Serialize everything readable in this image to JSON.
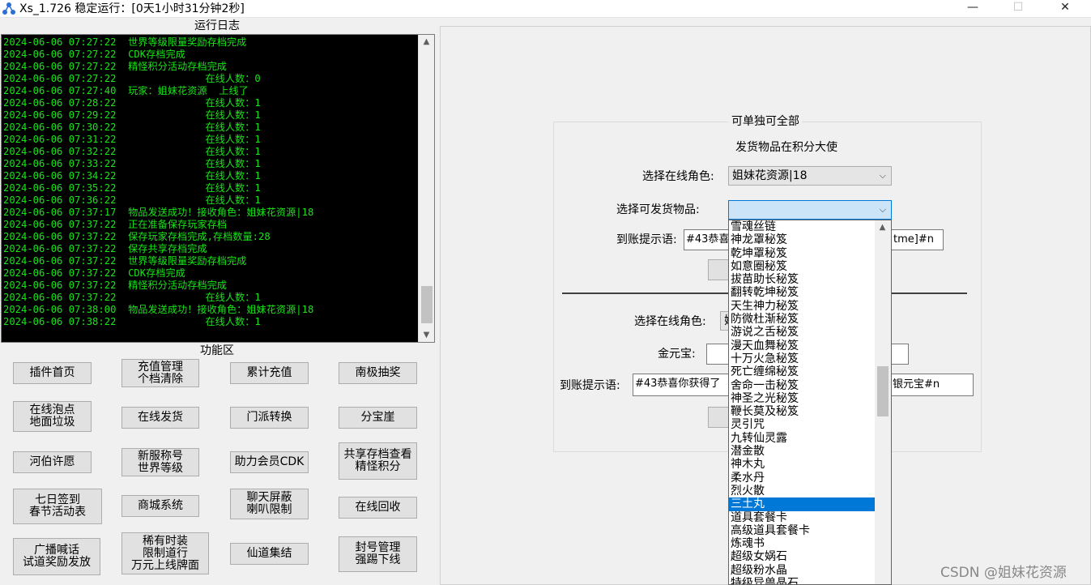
{
  "window": {
    "title": "Xs_1.726 稳定运行：[0天1小时31分钟2秒]",
    "minimize": "—",
    "maximize": "☐",
    "close": "✕"
  },
  "log": {
    "title": "运行日志",
    "lines": [
      "2024-06-06 07:27:22  世界等级限量奖励存档完成",
      "2024-06-06 07:27:22  CDK存档完成",
      "2024-06-06 07:27:22  精怪积分活动存档完成",
      "2024-06-06 07:27:22               在线人数：0",
      "2024-06-06 07:27:40  玩家：姐妹花资源  上线了",
      "2024-06-06 07:28:22               在线人数：1",
      "2024-06-06 07:29:22               在线人数：1",
      "2024-06-06 07:30:22               在线人数：1",
      "2024-06-06 07:31:22               在线人数：1",
      "2024-06-06 07:32:22               在线人数：1",
      "2024-06-06 07:33:22               在线人数：1",
      "2024-06-06 07:34:22               在线人数：1",
      "2024-06-06 07:35:22               在线人数：1",
      "2024-06-06 07:36:22               在线人数：1",
      "2024-06-06 07:37:17  物品发送成功！接收角色：姐妹花资源|18",
      "2024-06-06 07:37:22  正在准备保存玩家存档",
      "2024-06-06 07:37:22  保存玩家存档完成,存档数量:28",
      "2024-06-06 07:37:22  保存共享存档完成",
      "2024-06-06 07:37:22  世界等级限量奖励存档完成",
      "2024-06-06 07:37:22  CDK存档完成",
      "2024-06-06 07:37:22  精怪积分活动存档完成",
      "2024-06-06 07:37:22               在线人数：1",
      "2024-06-06 07:38:00  物品发送成功！接收角色：姐妹花资源|18",
      "2024-06-06 07:38:22               在线人数：1"
    ],
    "scroll_position": 0.88
  },
  "functions": {
    "title": "功能区",
    "buttons": [
      {
        "name": "plugin-home",
        "lines": [
          "插件首页"
        ]
      },
      {
        "name": "recharge-manage",
        "lines": [
          "充值管理",
          "个档清除"
        ]
      },
      {
        "name": "cumulative-recharge",
        "lines": [
          "累计充值"
        ]
      },
      {
        "name": "nanji-lottery",
        "lines": [
          "南极抽奖"
        ]
      },
      {
        "name": "online-bubble",
        "lines": [
          "在线泡点",
          "地面垃圾"
        ]
      },
      {
        "name": "online-delivery",
        "lines": [
          "在线发货"
        ]
      },
      {
        "name": "sect-transfer",
        "lines": [
          "门派转换"
        ]
      },
      {
        "name": "treasure-cliff",
        "lines": [
          "分宝崖"
        ]
      },
      {
        "name": "hebo-wish",
        "lines": [
          "河伯许愿"
        ]
      },
      {
        "name": "new-server-title",
        "lines": [
          "新服称号",
          "世界等级"
        ]
      },
      {
        "name": "member-cdk",
        "lines": [
          "助力会员CDK"
        ]
      },
      {
        "name": "shared-save",
        "lines": [
          "共享存档查看",
          "精怪积分"
        ]
      },
      {
        "name": "seven-day-signin",
        "lines": [
          "七日签到",
          "春节活动表"
        ]
      },
      {
        "name": "mall-system",
        "lines": [
          "商城系统"
        ]
      },
      {
        "name": "chat-filter",
        "lines": [
          "聊天屏蔽",
          "喇叭限制"
        ]
      },
      {
        "name": "online-recycle",
        "lines": [
          "在线回收"
        ]
      },
      {
        "name": "broadcast",
        "lines": [
          "广播喊话",
          "试道奖励发放"
        ]
      },
      {
        "name": "rare-equip",
        "lines": [
          "稀有时装",
          "限制道行",
          "万元上线牌面"
        ]
      },
      {
        "name": "immortal-gather",
        "lines": [
          "仙道集结"
        ]
      },
      {
        "name": "ban-manage",
        "lines": [
          "封号管理",
          "强踢下线"
        ]
      }
    ]
  },
  "delivery": {
    "group_title": "可单独可全部",
    "subtitle": "发货物品在积分大使",
    "role_label": "选择在线角色:",
    "role_value": "姐妹花资源|18",
    "item_label": "选择可发货物品:",
    "item_value": "",
    "notice_label": "到账提示语:",
    "notice_value_left": "#43恭喜",
    "notice_value_right": "tme]#n",
    "role_label2": "选择在线角色:",
    "role_value2": "姐",
    "gold_label": "金元宝:",
    "gold_value": "",
    "notice_label2": "到账提示语:",
    "notice_value2_left": "#43恭喜你获得了",
    "notice_value2_right": "银元宝#n",
    "dropdown_items": [
      "雪魂丝链",
      "神龙罩秘笈",
      "乾坤罩秘笈",
      "如意圈秘笈",
      "拔苗助长秘笈",
      "翻转乾坤秘笈",
      "天生神力秘笈",
      "防微杜渐秘笈",
      "游说之舌秘笈",
      "漫天血舞秘笈",
      "十万火急秘笈",
      "死亡缠绵秘笈",
      "舍命一击秘笈",
      "神圣之光秘笈",
      "鞭长莫及秘笈",
      "灵引咒",
      "九转仙灵露",
      "潜金散",
      "神木丸",
      "柔水丹",
      "烈火散",
      "三土丸",
      "道具套餐卡",
      "高级道具套餐卡",
      "炼魂书",
      "超级女娲石",
      "超级粉水晶",
      "特级异兽晶石"
    ],
    "dropdown_selected_index": 21
  },
  "watermark": "CSDN @姐妹花资源"
}
